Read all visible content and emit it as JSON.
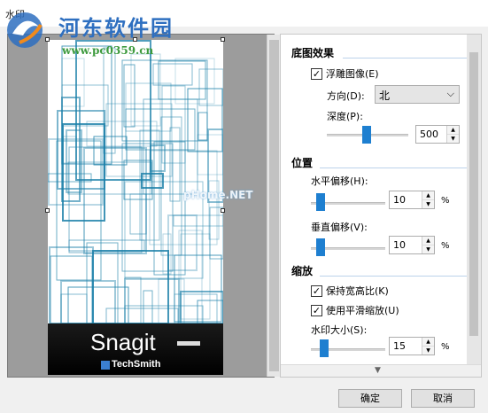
{
  "window": {
    "title": "水印"
  },
  "overlay": {
    "logo_text": "河东软件园",
    "logo_url": "www.pc0359.cn",
    "center_mark": "pHome.NET"
  },
  "preview": {
    "brand": "Snagit",
    "company": "TechSmith"
  },
  "sections": {
    "effect": {
      "heading": "底图效果",
      "emboss_label": "浮雕图像(E)",
      "emboss_checked": true,
      "direction_label": "方向(D):",
      "direction_value": "北",
      "depth_label": "深度(P):",
      "depth_value": "500"
    },
    "position": {
      "heading": "位置",
      "h_offset_label": "水平偏移(H):",
      "h_offset_value": "10",
      "v_offset_label": "垂直偏移(V):",
      "v_offset_value": "10",
      "unit": "%"
    },
    "scale": {
      "heading": "缩放",
      "keep_ratio_label": "保持宽高比(K)",
      "keep_ratio_checked": true,
      "smooth_label": "使用平滑缩放(U)",
      "smooth_checked": true,
      "size_label": "水印大小(S):",
      "size_value": "15",
      "unit": "%"
    }
  },
  "buttons": {
    "ok": "确定",
    "cancel": "取消"
  },
  "colors": {
    "accent": "#1e7fd0",
    "pattern": "#1a7fa8"
  }
}
